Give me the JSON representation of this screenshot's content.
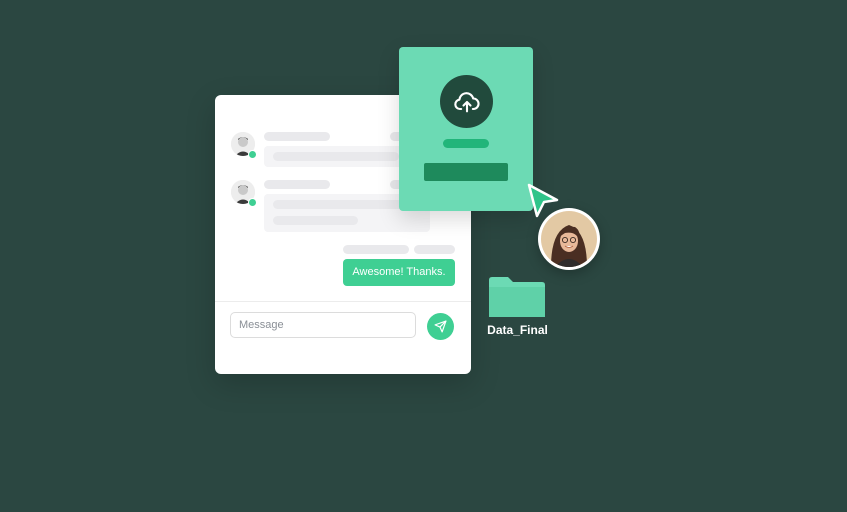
{
  "chat": {
    "sent_message": "Awesome! Thanks.",
    "input": {
      "placeholder": "Message",
      "value": ""
    },
    "send_icon": "send-icon",
    "online_color": "#3fcf93"
  },
  "upload_card": {
    "icon": "cloud-upload-icon",
    "accent": "#6cdab4"
  },
  "folder": {
    "name": "Data_Final",
    "icon": "folder-icon"
  },
  "colors": {
    "background": "#2b4741",
    "brand_green": "#3fcf93"
  }
}
